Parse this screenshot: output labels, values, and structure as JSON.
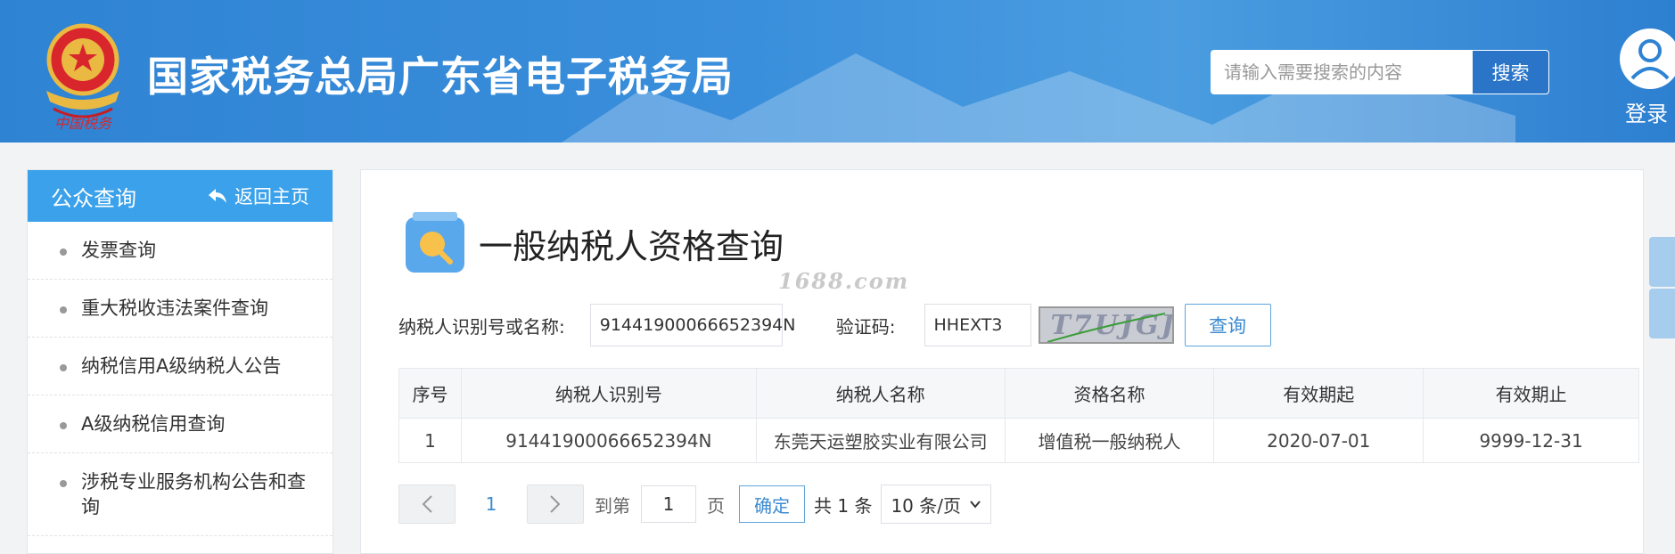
{
  "header": {
    "site_title": "国家税务总局广东省电子税务局",
    "search_placeholder": "请输入需要搜索的内容",
    "search_button": "搜索",
    "login_label": "登录",
    "emblem_text": "中国税务"
  },
  "sidebar": {
    "title": "公众查询",
    "back_label": "返回主页",
    "items": [
      {
        "label": "发票查询"
      },
      {
        "label": "重大税收违法案件查询"
      },
      {
        "label": "纳税信用A级纳税人公告"
      },
      {
        "label": "A级纳税信用查询"
      },
      {
        "label": "涉税专业服务机构公告和查询"
      }
    ]
  },
  "main": {
    "page_title": "一般纳税人资格查询",
    "watermark": "1688.com",
    "form": {
      "taxpayer_label": "纳税人识别号或名称:",
      "taxpayer_value": "91441900066652394N",
      "captcha_label": "验证码:",
      "captcha_value": "HHEXT3",
      "captcha_image_text": "T7UJGJ",
      "query_button": "查询"
    },
    "table": {
      "headers": [
        "序号",
        "纳税人识别号",
        "纳税人名称",
        "资格名称",
        "有效期起",
        "有效期止"
      ],
      "rows": [
        [
          "1",
          "91441900066652394N",
          "东莞天运塑胶实业有限公司",
          "增值税一般纳税人",
          "2020-07-01",
          "9999-12-31"
        ]
      ]
    },
    "pager": {
      "current_page": "1",
      "goto_label": "到第",
      "goto_value": "1",
      "page_unit": "页",
      "confirm": "确定",
      "total": "共 1 条",
      "page_size": "10 条/页"
    }
  },
  "colors": {
    "header_blue": "#3a8fdc",
    "sidebar_head": "#3aa1ea",
    "link_blue": "#3b8bd1"
  }
}
